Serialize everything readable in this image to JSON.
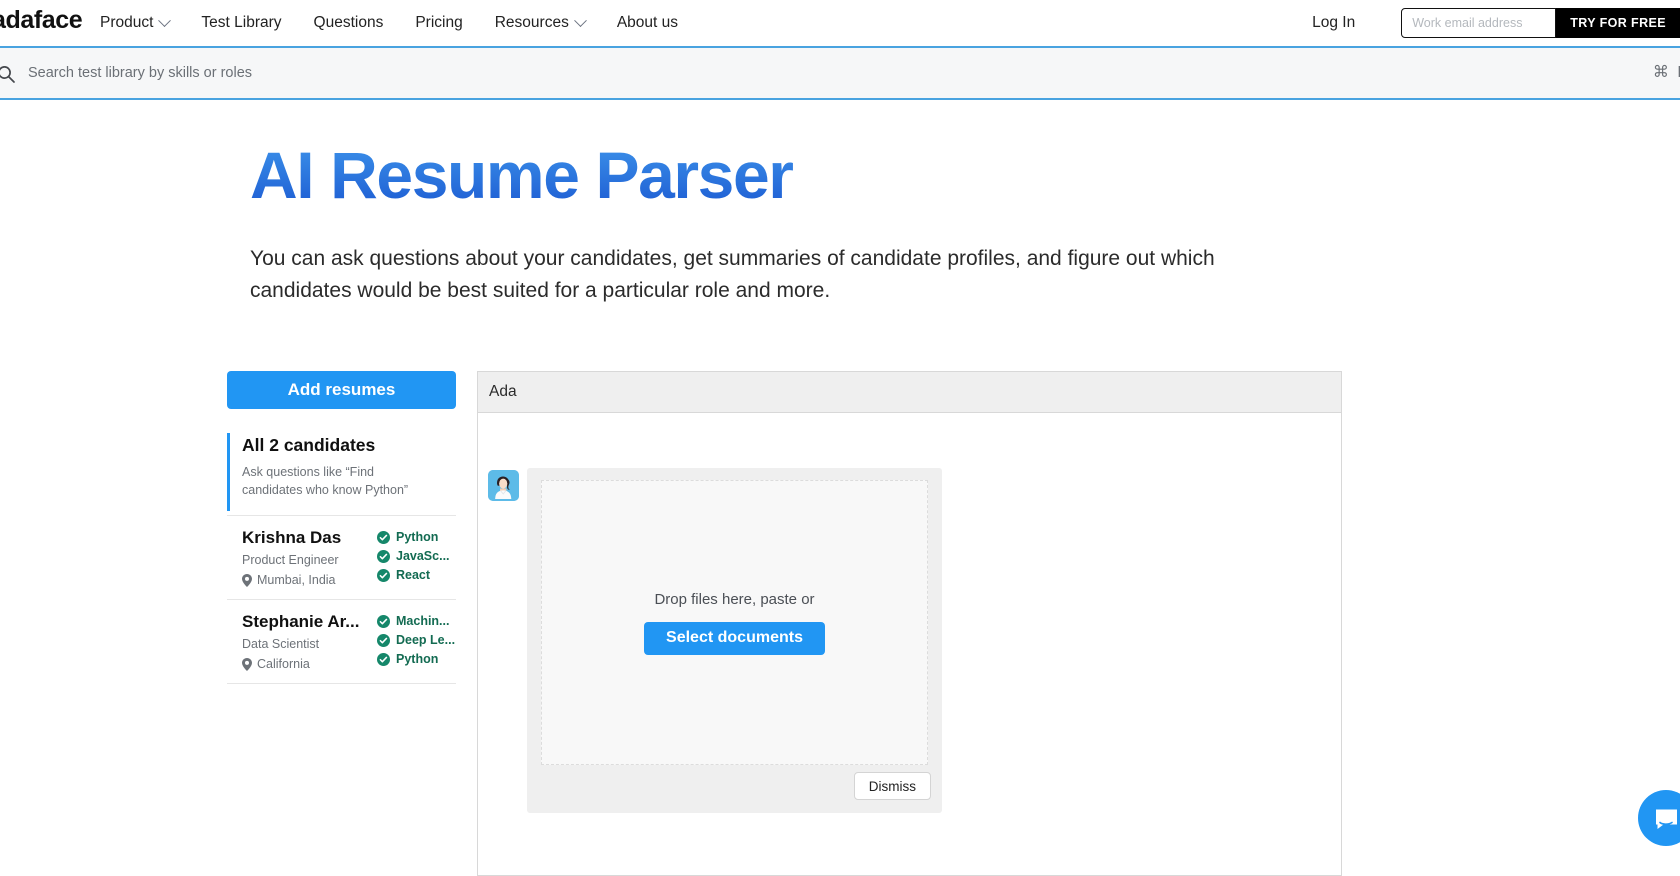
{
  "nav": {
    "brand": "adaface",
    "items": [
      {
        "label": "Product",
        "has_caret": true
      },
      {
        "label": "Test Library",
        "has_caret": false
      },
      {
        "label": "Questions",
        "has_caret": false
      },
      {
        "label": "Pricing",
        "has_caret": false
      },
      {
        "label": "Resources",
        "has_caret": true
      },
      {
        "label": "About us",
        "has_caret": false
      }
    ],
    "login_label": "Log In",
    "email_placeholder": "Work email address",
    "cta_label": "TRY FOR FREE"
  },
  "search": {
    "placeholder": "Search test library by skills or roles",
    "value": "",
    "shortcut_hint": "⌘ K"
  },
  "hero": {
    "title": "AI Resume Parser",
    "subtitle": "You can ask questions about your candidates, get summaries of candidate profiles, and figure out which candidates would be best suited for a particular role and more."
  },
  "sidebar": {
    "add_button_label": "Add resumes",
    "all_candidates": {
      "title": "All 2 candidates",
      "hint": "Ask questions like “Find candidates who know Python”",
      "selected": true
    },
    "candidates": [
      {
        "name": "Krishna Das",
        "role": "Product Engineer",
        "location": "Mumbai, India",
        "skills": [
          "Python",
          "JavaSc...",
          "React"
        ]
      },
      {
        "name": "Stephanie Ar...",
        "role": "Data Scientist",
        "location": "California",
        "skills": [
          "Machin...",
          "Deep Le...",
          "Python"
        ]
      }
    ]
  },
  "panel": {
    "header_title": "Ada",
    "upload": {
      "drop_text": "Drop files here, paste or",
      "select_label": "Select documents",
      "dismiss_label": "Dismiss"
    }
  },
  "widgets": {
    "chat_icon": "chat-bubble-icon"
  },
  "colors": {
    "accent_blue": "#2196f3",
    "title_gradient_from": "#3d93ea",
    "title_gradient_to": "#1f5fd4",
    "cta_black": "#000000",
    "skill_green": "#136b52",
    "search_border": "#49a3e0"
  }
}
